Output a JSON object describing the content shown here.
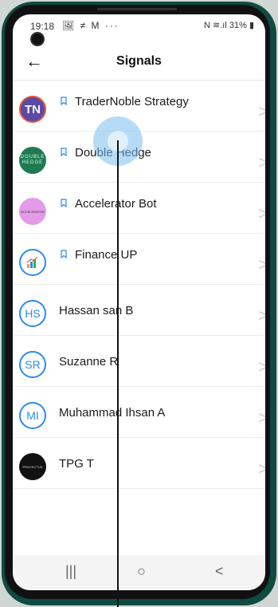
{
  "status_bar": {
    "time": "19:18",
    "left_icons": "🖼 ≠ M ···",
    "right_icons": "N ≋.ıl",
    "battery": "31%"
  },
  "header": {
    "back_icon": "arrow-left-icon",
    "title": "Signals"
  },
  "items": [
    {
      "name": "TraderNoble Strategy",
      "avatar_text": "TN",
      "bookmarked": true
    },
    {
      "name": "Double Hedge",
      "avatar_text": "DOUBLE HEDGE",
      "bookmarked": true
    },
    {
      "name": "Accelerator Bot",
      "avatar_text": "ACCELERATOR",
      "bookmarked": true
    },
    {
      "name": "Finance UP",
      "avatar_text": "",
      "bookmarked": true
    },
    {
      "name": "Hassan san B",
      "avatar_text": "HS",
      "bookmarked": false
    },
    {
      "name": "Suzanne R",
      "avatar_text": "SR",
      "bookmarked": false
    },
    {
      "name": "Muhammad Ihsan A",
      "avatar_text": "MI",
      "bookmarked": false
    },
    {
      "name": "TPG T",
      "avatar_text": "PROYECTUS",
      "bookmarked": false
    }
  ],
  "nav": {
    "recents": "|||",
    "home": "○",
    "back": "<"
  },
  "colors": {
    "accent": "#2a8bf2",
    "phone_frame": "#0f4b40"
  }
}
